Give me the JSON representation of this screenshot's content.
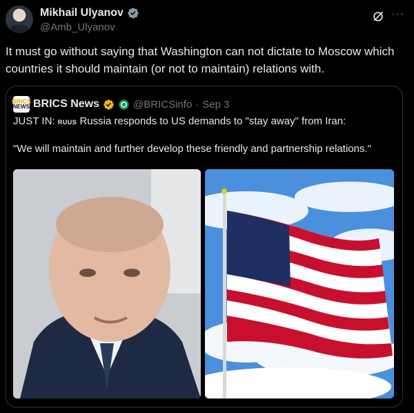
{
  "author": {
    "name": "Mikhail Ulyanov",
    "handle": "@Amb_Ulyanov",
    "more_label": "···"
  },
  "tweet": {
    "text": "It must go without saying that Washington can not dictate to Moscow which countries it  should maintain (or not to maintain) relations with."
  },
  "quoted": {
    "avatar_text_top": "BRICS",
    "avatar_text_bottom": "NEWS",
    "name": "BRICS News",
    "handle": "@BRICSinfo",
    "separator": "·",
    "date": "Sep 3",
    "line1_prefix": "JUST IN:",
    "line1_flag": "RUUS",
    "line1_rest": "Russia responds to US demands to \"stay away\" from Iran:",
    "line2": "\"We will maintain and further develop these friendly and partnership relations.\""
  },
  "colors": {
    "background": "#000000",
    "text": "#e7e9ea",
    "muted": "#71767b",
    "border": "#2f3336",
    "verified_blue": "#1d9bf0",
    "verified_gold": "#e2b719"
  }
}
